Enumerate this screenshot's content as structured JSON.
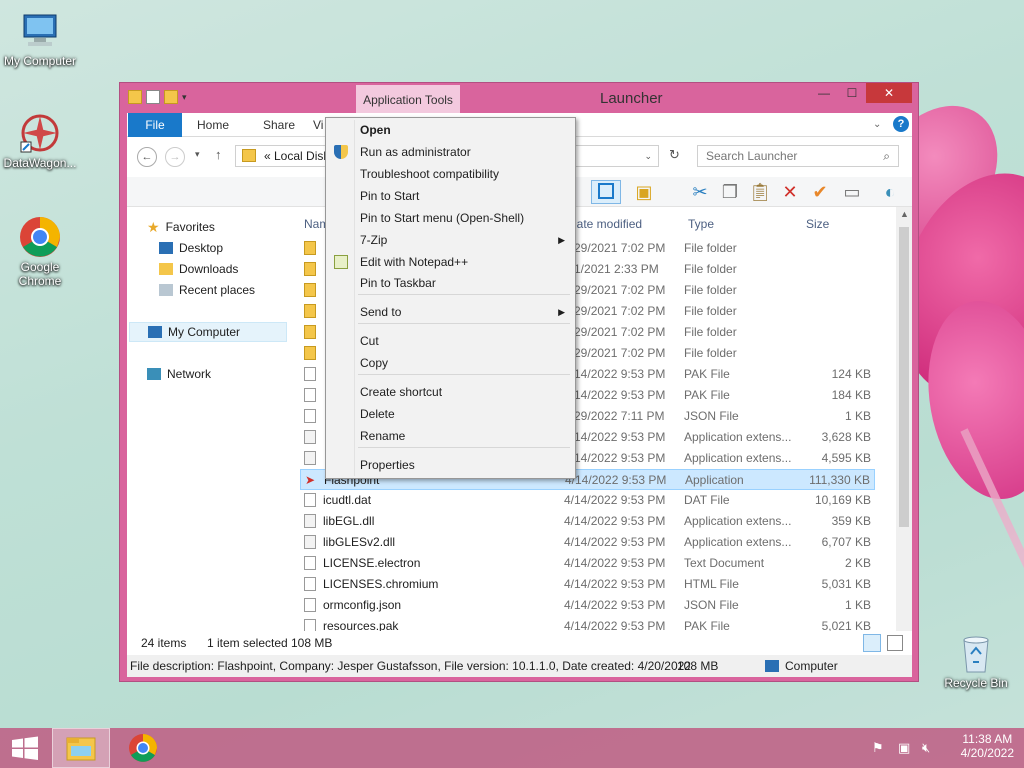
{
  "desktop": {
    "icons": [
      {
        "label": "My Computer"
      },
      {
        "label": "DataWagon..."
      },
      {
        "label": "Google Chrome"
      },
      {
        "label": "Recycle Bin"
      }
    ]
  },
  "window": {
    "title": "Launcher",
    "app_tools": "Application Tools",
    "close": "✕",
    "minimize": "—",
    "maximize": "☐",
    "ribbon_tabs": [
      "File",
      "Home",
      "Share",
      "Vi"
    ],
    "address": "« Local Disk",
    "search_placeholder": "Search Launcher",
    "nav": {
      "favorites": "Favorites",
      "desktop": "Desktop",
      "downloads": "Downloads",
      "recent": "Recent places",
      "computer": "My Computer",
      "network": "Network"
    },
    "columns": {
      "name": "Name",
      "date": "Date modified",
      "type": "Type",
      "size": "Size"
    },
    "files": [
      {
        "name": "",
        "date": "3/29/2021 7:02 PM",
        "type": "File folder",
        "size": "",
        "kind": "folder"
      },
      {
        "name": "",
        "date": "4/1/2021 2:33 PM",
        "type": "File folder",
        "size": "",
        "kind": "folder"
      },
      {
        "name": "",
        "date": "3/29/2021 7:02 PM",
        "type": "File folder",
        "size": "",
        "kind": "folder"
      },
      {
        "name": "",
        "date": "3/29/2021 7:02 PM",
        "type": "File folder",
        "size": "",
        "kind": "folder"
      },
      {
        "name": "",
        "date": "3/29/2021 7:02 PM",
        "type": "File folder",
        "size": "",
        "kind": "folder"
      },
      {
        "name": "",
        "date": "3/29/2021 7:02 PM",
        "type": "File folder",
        "size": "",
        "kind": "folder"
      },
      {
        "name": "",
        "date": "4/14/2022 9:53 PM",
        "type": "PAK File",
        "size": "124 KB",
        "kind": "file"
      },
      {
        "name": "",
        "date": "4/14/2022 9:53 PM",
        "type": "PAK File",
        "size": "184 KB",
        "kind": "file"
      },
      {
        "name": "",
        "date": "3/29/2022 7:11 PM",
        "type": "JSON File",
        "size": "1 KB",
        "kind": "file"
      },
      {
        "name": "",
        "date": "4/14/2022 9:53 PM",
        "type": "Application extens...",
        "size": "3,628 KB",
        "kind": "dll"
      },
      {
        "name": "",
        "date": "4/14/2022 9:53 PM",
        "type": "Application extens...",
        "size": "4,595 KB",
        "kind": "dll"
      },
      {
        "name": "Flashpoint",
        "date": "4/14/2022 9:53 PM",
        "type": "Application",
        "size": "111,330 KB",
        "kind": "app"
      },
      {
        "name": "icudtl.dat",
        "date": "4/14/2022 9:53 PM",
        "type": "DAT File",
        "size": "10,169 KB",
        "kind": "file"
      },
      {
        "name": "libEGL.dll",
        "date": "4/14/2022 9:53 PM",
        "type": "Application extens...",
        "size": "359 KB",
        "kind": "dll"
      },
      {
        "name": "libGLESv2.dll",
        "date": "4/14/2022 9:53 PM",
        "type": "Application extens...",
        "size": "6,707 KB",
        "kind": "dll"
      },
      {
        "name": "LICENSE.electron",
        "date": "4/14/2022 9:53 PM",
        "type": "Text Document",
        "size": "2 KB",
        "kind": "file"
      },
      {
        "name": "LICENSES.chromium",
        "date": "4/14/2022 9:53 PM",
        "type": "HTML File",
        "size": "5,031 KB",
        "kind": "file"
      },
      {
        "name": "ormconfig.json",
        "date": "4/14/2022 9:53 PM",
        "type": "JSON File",
        "size": "1 KB",
        "kind": "file"
      },
      {
        "name": "resources.pak",
        "date": "4/14/2022 9:53 PM",
        "type": "PAK File",
        "size": "5,021 KB",
        "kind": "file"
      }
    ],
    "status": {
      "count": "24 items",
      "selected": "1 item selected",
      "selsize": "108 MB"
    },
    "details": {
      "description": "File description: Flashpoint, Company: Jesper Gustafsson, File version: 10.1.1.0, Date created: 4/20/2022",
      "size": "108 MB",
      "location": "Computer"
    }
  },
  "context_menu": {
    "items": [
      {
        "label": "Open",
        "bold": true
      },
      {
        "label": "Run as administrator",
        "icon": "shield-icon"
      },
      {
        "label": "Troubleshoot compatibility"
      },
      {
        "label": "Pin to Start"
      },
      {
        "label": "Pin to Start menu (Open-Shell)"
      },
      {
        "label": "7-Zip",
        "submenu": true
      },
      {
        "label": "Edit with Notepad++",
        "icon": "notepad-icon"
      },
      {
        "label": "Pin to Taskbar"
      },
      {
        "label": "Send to",
        "submenu": true
      },
      {
        "label": "Cut"
      },
      {
        "label": "Copy"
      },
      {
        "label": "Create shortcut"
      },
      {
        "label": "Delete"
      },
      {
        "label": "Rename"
      },
      {
        "label": "Properties"
      }
    ]
  },
  "taskbar": {
    "time": "11:38 AM",
    "date": "4/20/2022"
  },
  "colors": {
    "window_frame": "#d9649d",
    "file_tab": "#1979ca",
    "selection": "#cce8ff",
    "taskbar": "#be5c82"
  }
}
